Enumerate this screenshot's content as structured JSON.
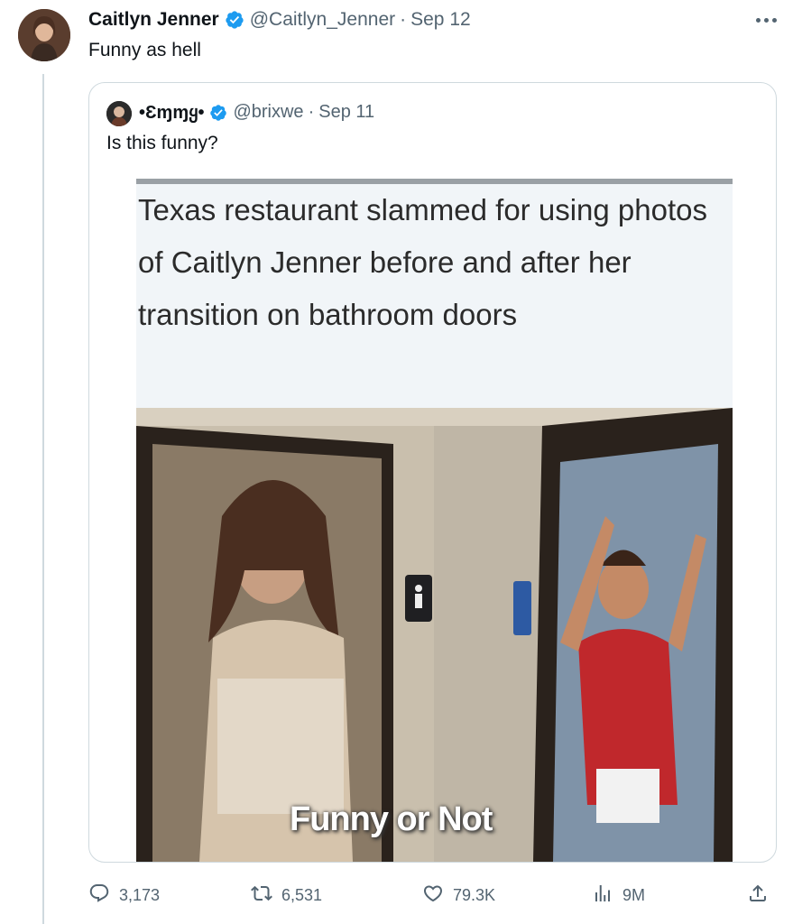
{
  "tweet": {
    "author_name": "Caitlyn Jenner",
    "handle": "@Caitlyn_Jenner",
    "separator": "·",
    "date": "Sep 12",
    "text": "Funny as hell"
  },
  "quoted_tweet": {
    "author_name": "•Ɛɱɱყ•",
    "handle": "@brixwe",
    "separator": "·",
    "date": "Sep 11",
    "text": "Is this funny?",
    "media": {
      "headline": "Texas restaurant slammed for using photos of Caitlyn Jenner before and after her transition on bathroom doors",
      "caption": "Funny or Not"
    }
  },
  "actions": {
    "replies": "3,173",
    "reposts": "6,531",
    "likes": "79.3K",
    "views": "9M"
  },
  "colors": {
    "verified": "#1d9bf0",
    "secondary_text": "#536471",
    "border": "#cfd9de"
  },
  "icons": [
    "verified-badge-icon",
    "more-icon",
    "reply-icon",
    "repost-icon",
    "like-icon",
    "views-icon",
    "share-icon"
  ]
}
